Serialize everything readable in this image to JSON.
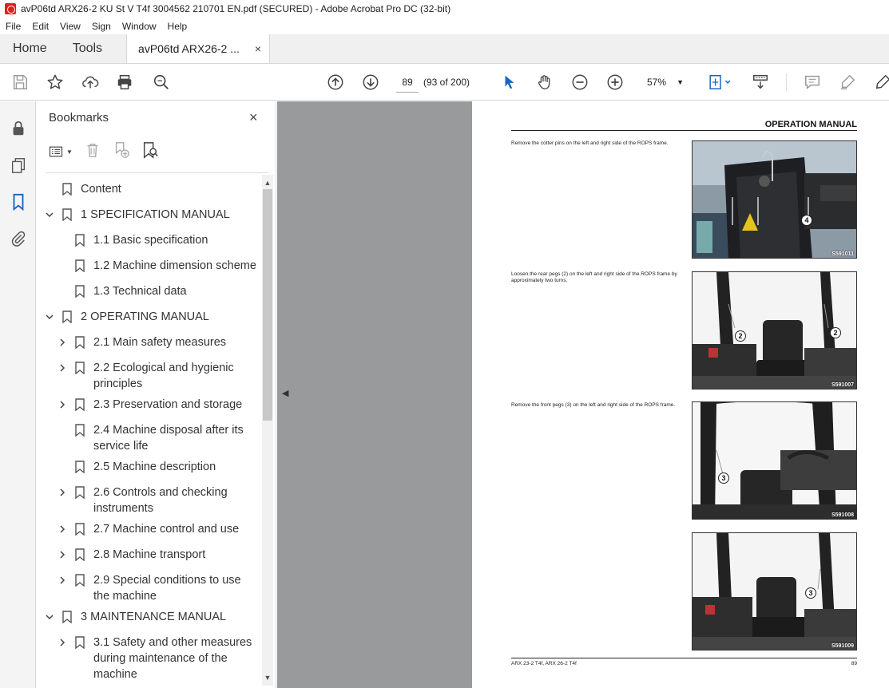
{
  "window": {
    "title": "avP06td ARX26-2 KU St V T4f 3004562 210701 EN.pdf (SECURED) - Adobe Acrobat Pro DC (32-bit)"
  },
  "menu": [
    "File",
    "Edit",
    "View",
    "Sign",
    "Window",
    "Help"
  ],
  "tabs": {
    "home": "Home",
    "tools": "Tools",
    "document": "avP06td ARX26-2 ...",
    "close": "×"
  },
  "toolbar": {
    "page_number": "89",
    "page_count": "(93 of 200)",
    "zoom": "57%"
  },
  "bookmarks": {
    "title": "Bookmarks",
    "close": "×",
    "items": [
      {
        "label": "Content"
      },
      {
        "label": "1 SPECIFICATION MANUAL"
      },
      {
        "label": "1.1 Basic specification"
      },
      {
        "label": "1.2 Machine dimension scheme"
      },
      {
        "label": "1.3 Technical data"
      },
      {
        "label": "2 OPERATING MANUAL"
      },
      {
        "label": "2.1 Main safety measures"
      },
      {
        "label": "2.2 Ecological and hygienic principles"
      },
      {
        "label": "2.3 Preservation and storage"
      },
      {
        "label": "2.4 Machine disposal after its service life"
      },
      {
        "label": "2.5 Machine description"
      },
      {
        "label": "2.6 Controls and checking instruments"
      },
      {
        "label": "2.7 Machine control and use"
      },
      {
        "label": "2.8 Machine transport"
      },
      {
        "label": "2.9 Special conditions to use the machine"
      },
      {
        "label": "3 MAINTENANCE MANUAL"
      },
      {
        "label": "3.1 Safety and other measures during maintenance of the machine"
      }
    ]
  },
  "page": {
    "header": "OPERATION MANUAL",
    "steps": [
      {
        "text": "Remove the cotter pins on the left and right side of the ROPS frame.",
        "image_code": "S591011",
        "callouts": [
          "4"
        ]
      },
      {
        "text": "Loosen the rear pegs (2) on the left and right side of the ROPS frame by approximately two turns.",
        "image_code": "S591007",
        "callouts": [
          "2",
          "2"
        ]
      },
      {
        "text": "Remove the front pegs (3) on the left and right side of the ROPS frame.",
        "image_code": "S591008",
        "callouts": [
          "3"
        ]
      },
      {
        "text": "",
        "image_code": "S591009",
        "callouts": [
          "3"
        ]
      }
    ],
    "footer_left": "ARX 23-2 T4f, ARX 26-2 T4f",
    "footer_right": "89"
  }
}
